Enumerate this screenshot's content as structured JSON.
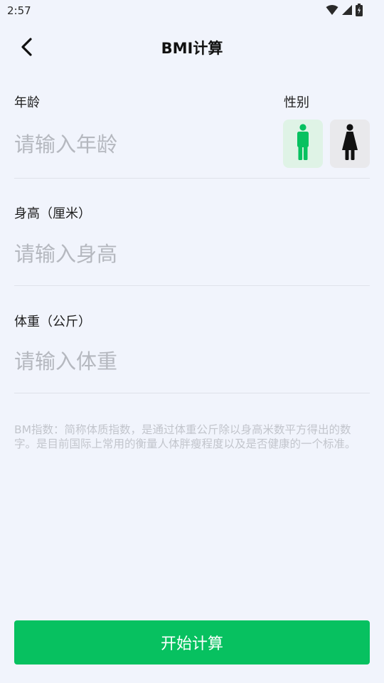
{
  "status_bar": {
    "time": "2:57",
    "icons": [
      "wifi-icon",
      "signal-icon",
      "battery-icon"
    ]
  },
  "header": {
    "back_icon": "chevron-left-icon",
    "title": "BMI计算"
  },
  "age": {
    "label": "年龄",
    "placeholder": "请输入年龄",
    "value": ""
  },
  "gender": {
    "label": "性别",
    "options": [
      {
        "icon": "male-icon",
        "selected": true,
        "color": "#07c160"
      },
      {
        "icon": "female-icon",
        "selected": false,
        "color": "#111111"
      }
    ]
  },
  "height": {
    "label": "身高（厘米）",
    "placeholder": "请输入身高",
    "value": ""
  },
  "weight": {
    "label": "体重（公斤）",
    "placeholder": "请输入体重",
    "value": ""
  },
  "description": "BM指数：简称体质指数，是通过体重公斤除以身高米数平方得出的数字。是目前国际上常用的衡量人体胖瘦程度以及是否健康的一个标准。",
  "start_button": {
    "label": "开始计算",
    "color": "#07c160"
  }
}
